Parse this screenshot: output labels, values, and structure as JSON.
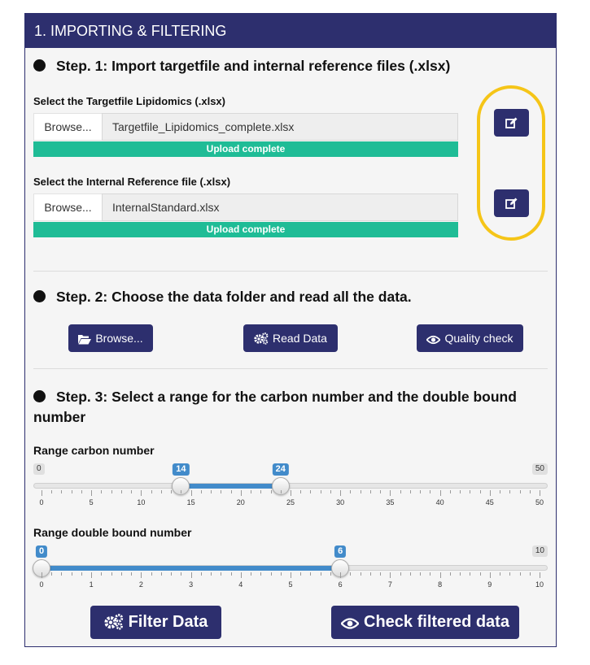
{
  "panel": {
    "title": "1. IMPORTING & FILTERING"
  },
  "step1": {
    "title": "Step. 1: Import targetfile and internal reference files (.xlsx)",
    "target_label": "Select the Targetfile Lipidomics (.xlsx)",
    "target_browse": "Browse...",
    "target_file": "Targetfile_Lipidomics_complete.xlsx",
    "target_status": "Upload complete",
    "internal_label": "Select the Internal Reference file (.xlsx)",
    "internal_browse": "Browse...",
    "internal_file": "InternalStandard.xlsx",
    "internal_status": "Upload complete",
    "edit_icon": "edit-icon",
    "highlight_color": "#f5c518"
  },
  "step2": {
    "title": "Step. 2: Choose the data folder and read all the data.",
    "browse_label": "Browse...",
    "read_label": "Read Data",
    "quality_label": "Quality check"
  },
  "step3": {
    "title": "Step. 3: Select a range for the carbon number and the double bound number",
    "carbon": {
      "label": "Range carbon number",
      "min": 0,
      "max": 50,
      "from": 14,
      "to": 24,
      "min_label": "0",
      "max_label": "50",
      "from_label": "14",
      "to_label": "24",
      "ticks": [
        "0",
        "5",
        "10",
        "15",
        "20",
        "25",
        "30",
        "35",
        "40",
        "45",
        "50"
      ]
    },
    "double": {
      "label": "Range double bound number",
      "min": 0,
      "max": 10,
      "from": 0,
      "to": 6,
      "max_label": "10",
      "from_label": "0",
      "to_label": "6",
      "ticks": [
        "0",
        "1",
        "2",
        "3",
        "4",
        "5",
        "6",
        "7",
        "8",
        "9",
        "10"
      ]
    }
  },
  "actions": {
    "filter_label": "Filter Data",
    "check_label": "Check filtered data"
  },
  "colors": {
    "primary": "#2d2f6e",
    "progress": "#1fbc96",
    "slider": "#428bca"
  }
}
